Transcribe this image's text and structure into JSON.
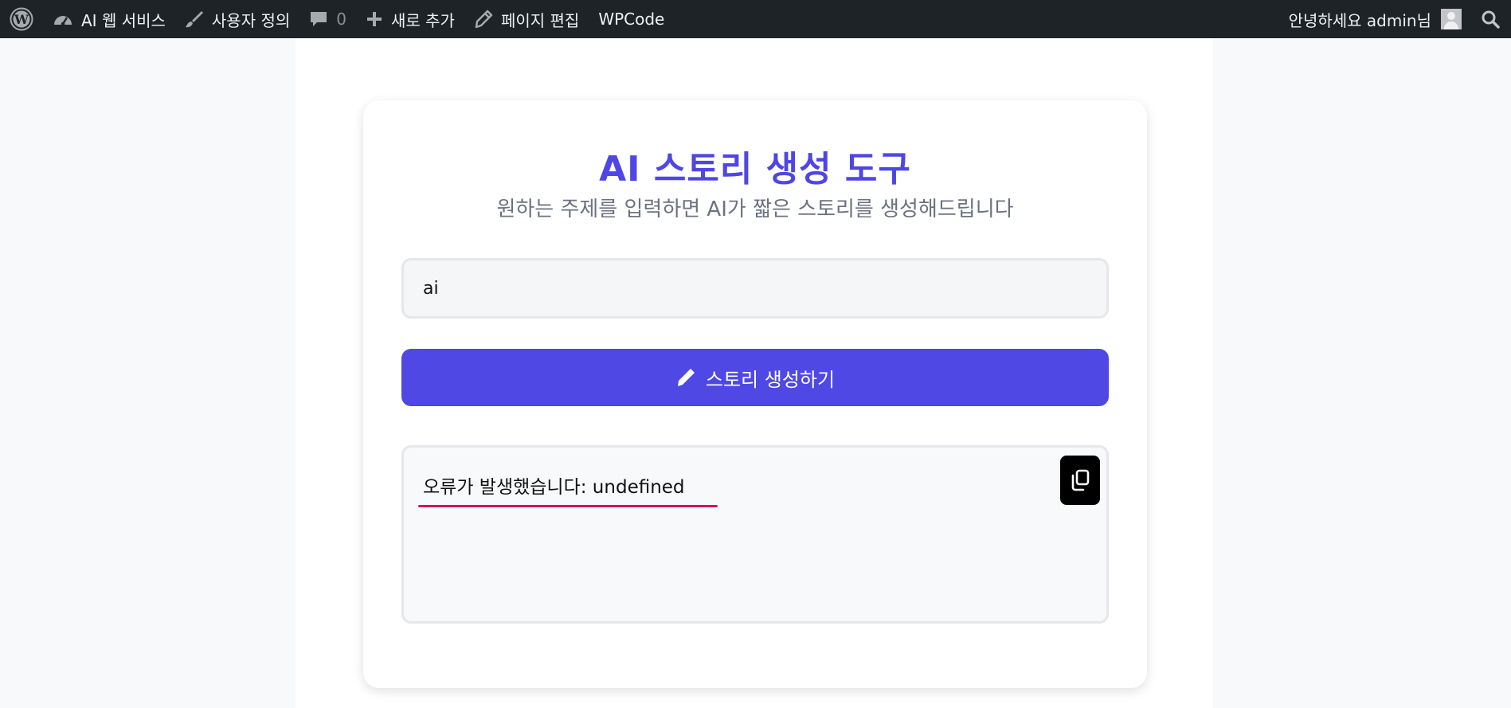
{
  "adminbar": {
    "site_name": "AI 웹 서비스",
    "customize": "사용자 정의",
    "comments_count": "0",
    "new": "새로 추가",
    "edit_page": "페이지 편집",
    "wpcode": "WPCode",
    "greeting": "안녕하세요 admin님"
  },
  "main": {
    "title": "AI 스토리 생성 도구",
    "subtitle": "원하는 주제를 입력하면 AI가 짧은 스토리를 생성해드립니다",
    "topic_value": "ai",
    "generate_label": "스토리 생성하기",
    "output_text": "오류가 발생했습니다: undefined"
  },
  "colors": {
    "accent": "#4f46e5",
    "button": "#5048e5",
    "adminbar": "#1d2327",
    "spellcheck": "#d4145a"
  }
}
